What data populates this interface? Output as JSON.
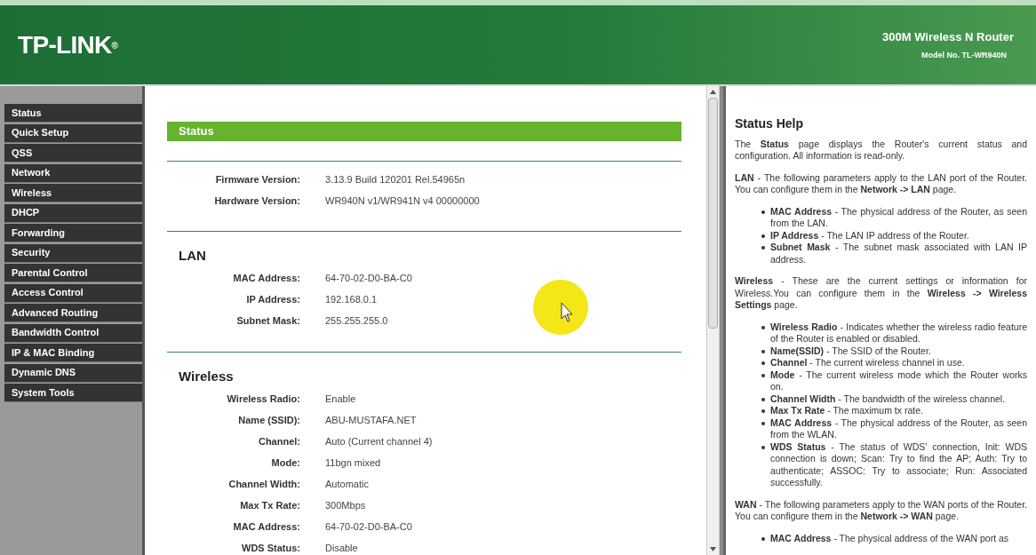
{
  "header": {
    "brand": "TP-LINK",
    "brand_mark": "®",
    "product": "300M Wireless N Router",
    "model": "Model No. TL-WR940N"
  },
  "menu": [
    {
      "label": "Status",
      "selected": false
    },
    {
      "label": "Quick Setup",
      "selected": false
    },
    {
      "label": "QSS",
      "selected": false
    },
    {
      "label": "Network",
      "selected": false
    },
    {
      "label": "Wireless",
      "selected": false
    },
    {
      "label": "DHCP",
      "selected": false
    },
    {
      "label": "Forwarding",
      "selected": false
    },
    {
      "label": "Security",
      "selected": false
    },
    {
      "label": "Parental Control",
      "selected": false
    },
    {
      "label": "Access Control",
      "selected": false
    },
    {
      "label": "Advanced Routing",
      "selected": false
    },
    {
      "label": "Bandwidth Control",
      "selected": false
    },
    {
      "label": "IP & MAC Binding",
      "selected": false
    },
    {
      "label": "Dynamic DNS",
      "selected": false
    },
    {
      "label": "System Tools",
      "selected": false
    }
  ],
  "main": {
    "title": "Status",
    "sections": [
      {
        "rows": [
          {
            "label": "Firmware Version:",
            "value": "3.13.9 Build 120201 Rel.54965n"
          },
          {
            "label": "Hardware Version:",
            "value": "WR940N v1/WR941N v4 00000000"
          }
        ]
      },
      {
        "heading": "LAN",
        "rows": [
          {
            "label": "MAC Address:",
            "value": "64-70-02-D0-BA-C0"
          },
          {
            "label": "IP Address:",
            "value": "192.168.0.1"
          },
          {
            "label": "Subnet Mask:",
            "value": "255.255.255.0"
          }
        ]
      },
      {
        "heading": "Wireless",
        "rows": [
          {
            "label": "Wireless Radio:",
            "value": "Enable"
          },
          {
            "label": "Name (SSID):",
            "value": "ABU-MUSTAFA.NET"
          },
          {
            "label": "Channel:",
            "value": "Auto (Current channel 4)"
          },
          {
            "label": "Mode:",
            "value": "11bgn mixed"
          },
          {
            "label": "Channel Width:",
            "value": "Automatic"
          },
          {
            "label": "Max Tx Rate:",
            "value": "300Mbps"
          },
          {
            "label": "MAC Address:",
            "value": "64-70-02-D0-BA-C0"
          },
          {
            "label": "WDS Status:",
            "value": "Disable"
          }
        ]
      }
    ]
  },
  "help": {
    "title": "Status Help",
    "blocks": [
      {
        "kind": "paragraph",
        "text": "The **Status** page displays the Router's current status and configuration. All information is read-only."
      },
      {
        "kind": "paragraph",
        "text": "**LAN** - The following parameters apply to the LAN port of the Router. You can configure them in the **Network -> LAN** page."
      },
      {
        "kind": "list",
        "items": [
          "**MAC Address** - The physical address of the Router, as seen from the LAN.",
          "**IP Address** - The LAN IP address of the Router.",
          "**Subnet Mask** - The subnet mask associated with LAN IP address."
        ]
      },
      {
        "kind": "paragraph",
        "text": "**Wireless** - These are the current settings or information for Wireless.You can configure them in the **Wireless -> Wireless Settings** page."
      },
      {
        "kind": "list",
        "items": [
          "**Wireless Radio** - Indicates whether the wireless radio feature of the Router is enabled or disabled.",
          "**Name(SSID)** - The SSID of the Router.",
          "**Channel** - The current wireless channel in use.",
          "**Mode** - The current wireless mode which the Router works on.",
          "**Channel Width** - The bandwidth of the wireless channel.",
          "**Max Tx Rate** - The maximum tx rate.",
          "**MAC Address** - The physical address of the Router, as seen from the WLAN.",
          "**WDS Status** - The status of WDS' connection, Init: WDS connection is down; Scan: Try to find the AP; Auth: Try to authenticate; ASSOC: Try to associate; Run: Associated successfully."
        ]
      },
      {
        "kind": "paragraph",
        "text": "**WAN** - The following parameters apply to the WAN ports of the Router. You can configure them in the **Network -> WAN** page."
      },
      {
        "kind": "list",
        "items": [
          "**MAC Address** - The physical address of the WAN port as"
        ]
      }
    ]
  }
}
